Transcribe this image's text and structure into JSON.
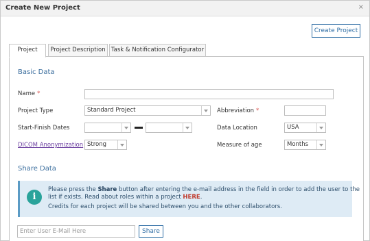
{
  "dialog": {
    "title": "Create New Project",
    "close_glyph": "×",
    "create_button": "Create Project"
  },
  "tabs": [
    {
      "label": "Project",
      "active": true
    },
    {
      "label": "Project Description",
      "active": false
    },
    {
      "label": "Task & Notification Configurator",
      "active": false
    }
  ],
  "basic_data": {
    "title": "Basic Data",
    "name_label": "Name",
    "required_mark": "*",
    "name_value": "",
    "project_type_label": "Project Type",
    "project_type_value": "Standard Project",
    "abbreviation_label": "Abbreviation",
    "abbreviation_value": "",
    "dates_label": "Start-Finish Dates",
    "start_date_value": "",
    "finish_date_value": "",
    "data_location_label": "Data Location",
    "data_location_value": "USA",
    "dicom_label": "DICOM Anonymization",
    "dicom_value": "Strong",
    "measure_age_label": "Measure of age",
    "measure_age_value": "Months"
  },
  "share_data": {
    "title": "Share Data",
    "info_icon": "i",
    "info_line1_prefix": "Please press the ",
    "info_line1_bold": "Share",
    "info_line1_suffix": " button after entering the e-mail address in the field in order to add the user to the",
    "info_line2_prefix": "list if exists. Read about roles within a project ",
    "info_line2_link": "HERE",
    "info_line2_suffix": ".",
    "info_line3": "Credits for each project will be shared between you and the other collaborators.",
    "email_placeholder": "Enter User E-Mail Here",
    "share_button": "Share"
  },
  "colors": {
    "accent": "#2e6da4",
    "section_title": "#3b6e9e",
    "info_bg": "#deebf5",
    "info_icon": "#2aa39b",
    "required": "#d9534f",
    "link_here": "#c0392b"
  }
}
